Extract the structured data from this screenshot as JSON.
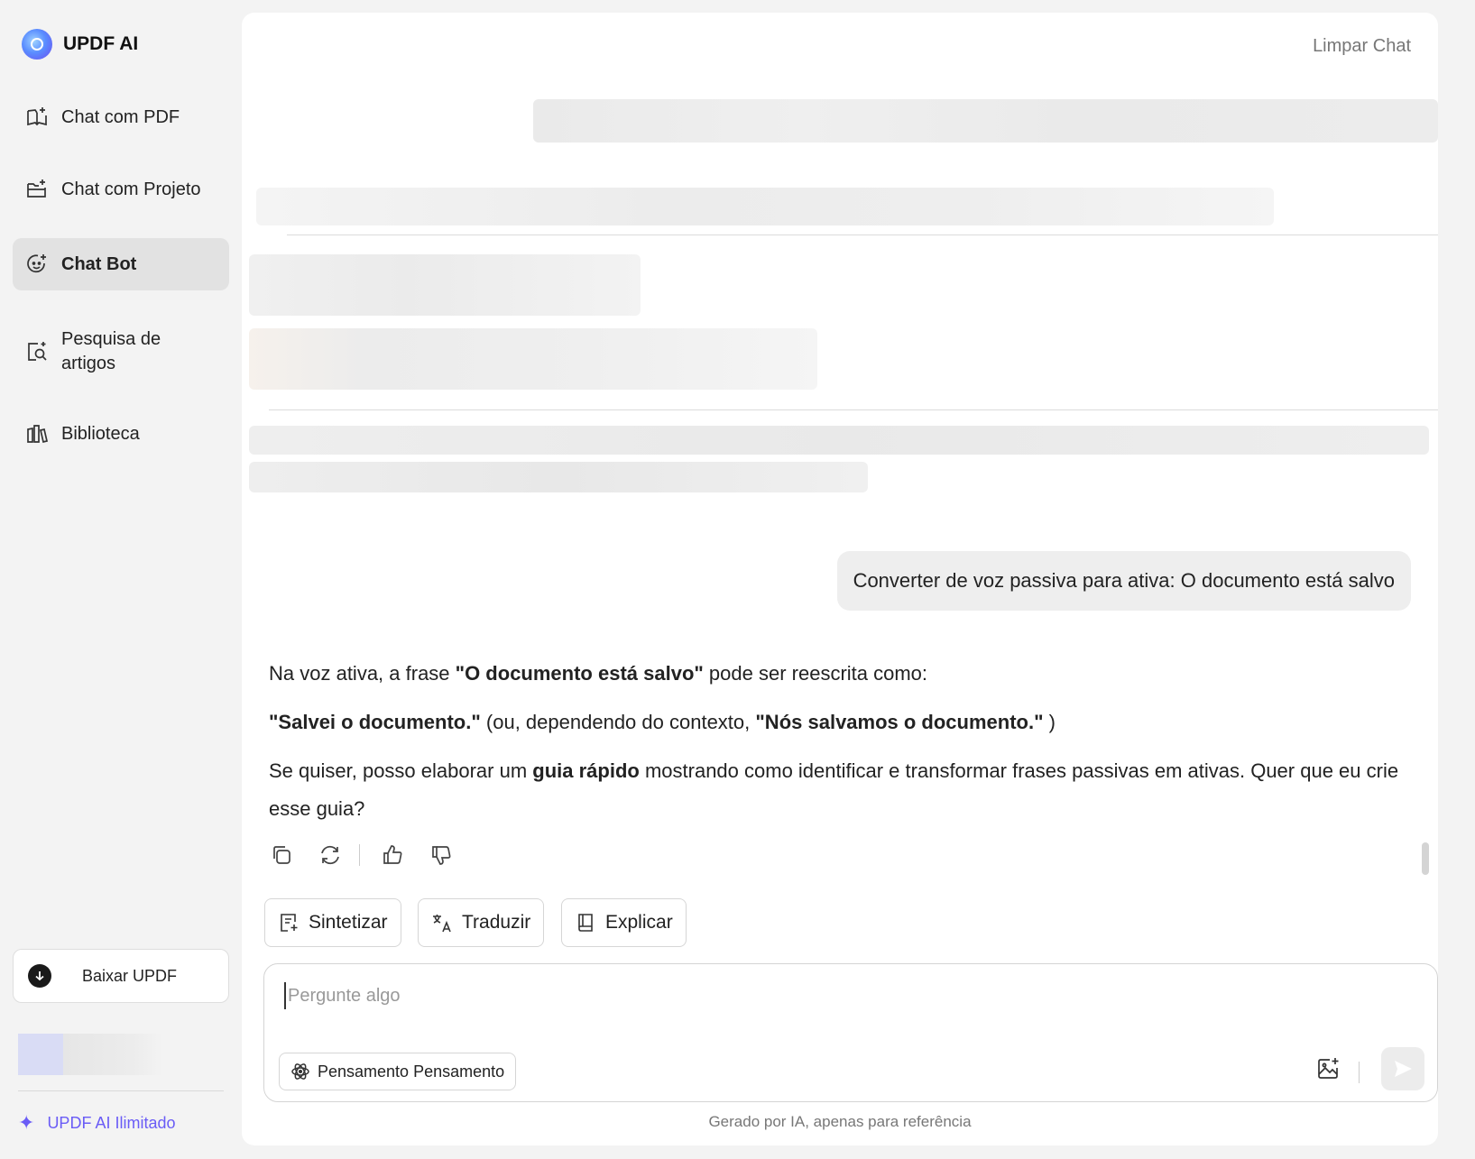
{
  "brand": {
    "name": "UPDF AI"
  },
  "sidebar": {
    "items": [
      {
        "label": "Chat com PDF"
      },
      {
        "label": "Chat com Projeto"
      },
      {
        "label": "Chat Bot"
      },
      {
        "label": "Pesquisa de artigos"
      },
      {
        "label": "Biblioteca"
      }
    ],
    "active_item": "Chat Bot",
    "download_label": "Baixar UPDF",
    "unlimited_label": "UPDF AI Ilimitado"
  },
  "header": {
    "clear_chat": "Limpar Chat"
  },
  "conversation": {
    "user_message": "Converter de voz passiva para ativa: O documento está salvo",
    "answer": {
      "p1_prefix": "Na voz ativa, a frase ",
      "p1_bold": "\"O documento está salvo\"",
      "p1_suffix": " pode ser reescrita como:",
      "p2_bold1": "\"Salvei o documento.\"",
      "p2_mid": " (ou, dependendo do contexto, ",
      "p2_bold2": "\"Nós salvamos o documento.\"",
      "p2_suffix": " )",
      "p3_prefix": "Se quiser, posso elaborar um ",
      "p3_bold": "guia rápido",
      "p3_suffix": " mostrando como identificar e transformar frases passivas em ativas. Quer que eu crie esse guia?"
    }
  },
  "quick_actions": [
    {
      "label": "Sintetizar"
    },
    {
      "label": "Traduzir"
    },
    {
      "label": "Explicar"
    }
  ],
  "composer": {
    "placeholder": "Pergunte algo",
    "value": "",
    "thinking_label": "Pensamento Pensamento"
  },
  "footer": {
    "note": "Gerado por IA, apenas para referência"
  },
  "colors": {
    "accent": "#6a5cf6",
    "active_bg": "#e2e2e2",
    "bubble_bg": "#eeeeee"
  }
}
